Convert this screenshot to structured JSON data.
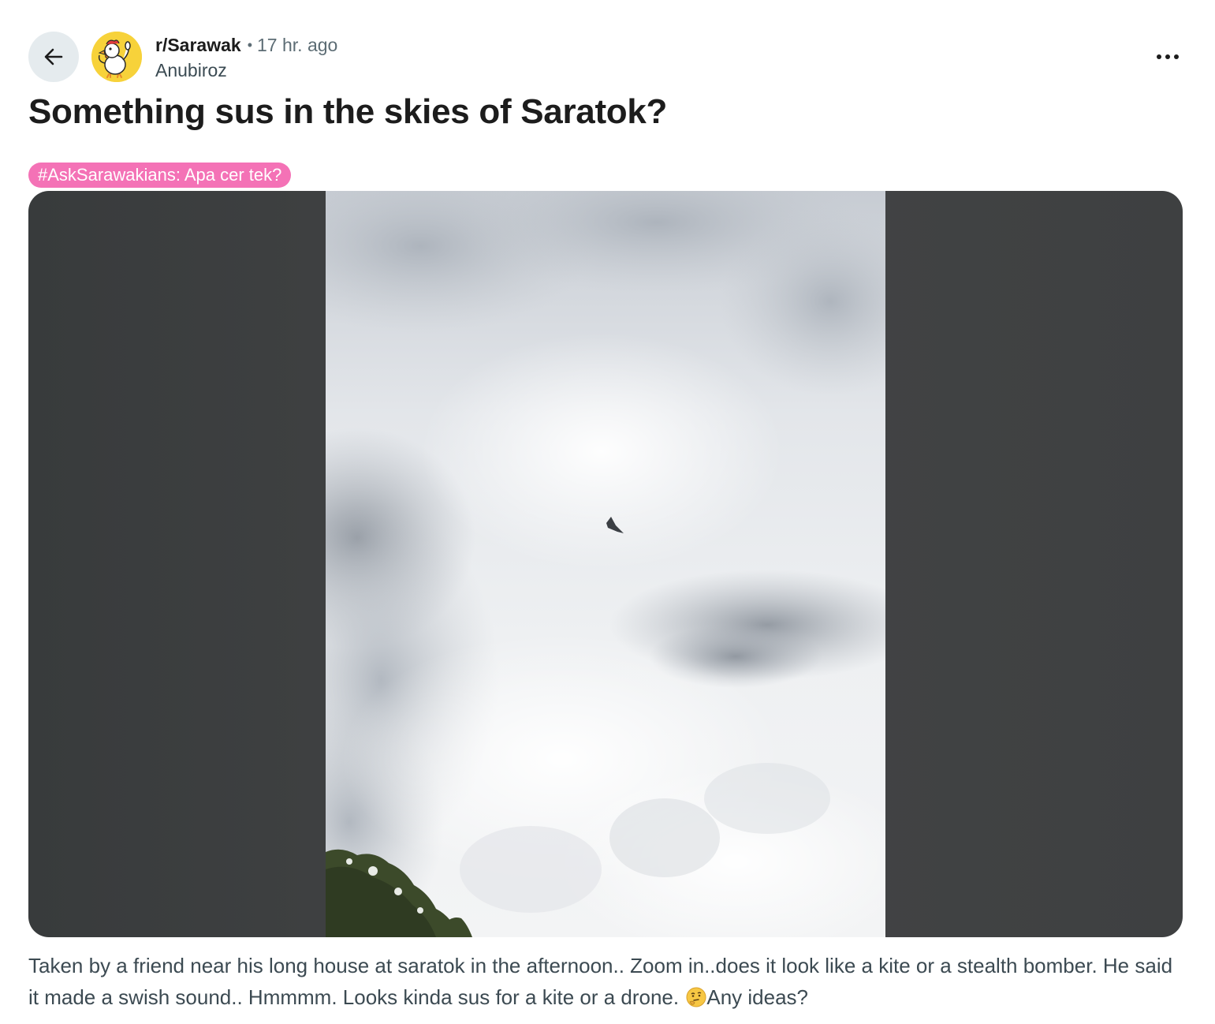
{
  "header": {
    "subreddit": "r/Sarawak",
    "separator": "•",
    "time": "17 hr. ago",
    "author": "Anubiroz",
    "back_icon": "arrow-left-icon",
    "more_icon": "ellipsis-icon",
    "more_label": "..."
  },
  "post": {
    "title": "Something sus in the skies of Saratok?",
    "flair": "#AskSarawakians: Apa cer tek?",
    "body_text": "Taken by a friend near his long house at saratok in the afternoon.. Zoom in..does it look like a kite or a stealth bomber. He said it made a swish sound.. Hmmmm. Looks kinda sus for a kite or a drone.",
    "body_emoji": "thinking-face-emoji",
    "body_tail": "Any ideas?"
  },
  "colors": {
    "flair_bg": "#f472b6",
    "back_button_bg": "#e5ebee",
    "avatar_bg": "#f7d23a"
  }
}
